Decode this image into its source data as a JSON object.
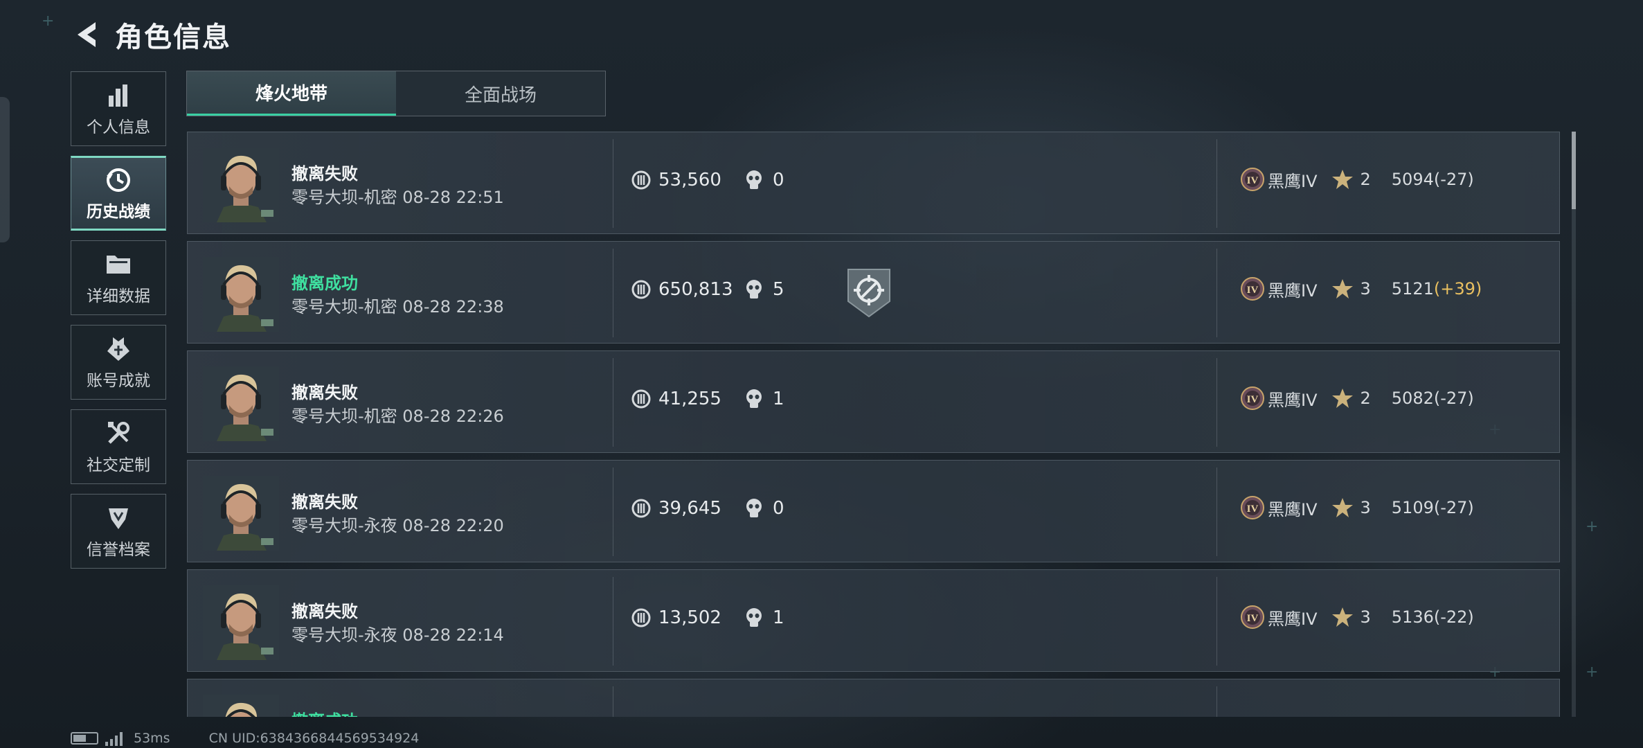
{
  "header": {
    "title": "角色信息",
    "back_icon": "back-arrow-icon"
  },
  "nav": {
    "items": [
      {
        "label": "个人信息",
        "icon": "bar-chart-icon",
        "active": false
      },
      {
        "label": "历史战绩",
        "icon": "clock-history-icon",
        "active": true
      },
      {
        "label": "详细数据",
        "icon": "folder-icon",
        "active": false
      },
      {
        "label": "账号成就",
        "icon": "achievement-badge-icon",
        "active": false
      },
      {
        "label": "社交定制",
        "icon": "tools-icon",
        "active": false
      },
      {
        "label": "信誉档案",
        "icon": "credit-shield-icon",
        "active": false
      }
    ]
  },
  "tabs": [
    {
      "label": "烽火地带",
      "active": true
    },
    {
      "label": "全面战场",
      "active": false
    }
  ],
  "records": [
    {
      "status": "撤离失败",
      "success": false,
      "map": "零号大坝-机密 08-28 22:51",
      "value": "53,560",
      "kills": "0",
      "medal": false,
      "rank": "黑鹰IV",
      "stars": "2",
      "score": "5094",
      "delta": "(-27)"
    },
    {
      "status": "撤离成功",
      "success": true,
      "map": "零号大坝-机密 08-28 22:38",
      "value": "650,813",
      "kills": "5",
      "medal": true,
      "rank": "黑鹰IV",
      "stars": "3",
      "score": "5121",
      "delta": "(+39)"
    },
    {
      "status": "撤离失败",
      "success": false,
      "map": "零号大坝-机密 08-28 22:26",
      "value": "41,255",
      "kills": "1",
      "medal": false,
      "rank": "黑鹰IV",
      "stars": "2",
      "score": "5082",
      "delta": "(-27)"
    },
    {
      "status": "撤离失败",
      "success": false,
      "map": "零号大坝-永夜 08-28 22:20",
      "value": "39,645",
      "kills": "0",
      "medal": false,
      "rank": "黑鹰IV",
      "stars": "3",
      "score": "5109",
      "delta": "(-27)"
    },
    {
      "status": "撤离失败",
      "success": false,
      "map": "零号大坝-永夜 08-28 22:14",
      "value": "13,502",
      "kills": "1",
      "medal": false,
      "rank": "黑鹰IV",
      "stars": "3",
      "score": "5136",
      "delta": "(-22)"
    },
    {
      "status": "撤离成功",
      "success": true,
      "map": "",
      "value": "",
      "kills": "",
      "medal": false,
      "rank": "",
      "stars": "",
      "score": "",
      "delta": ""
    }
  ],
  "footer": {
    "ping": "53ms",
    "uid": "CN UID:6384366844569534924"
  },
  "colors": {
    "success": "#3fe0a0",
    "accent": "#39d0a3",
    "positive_delta": "#e9c060"
  }
}
